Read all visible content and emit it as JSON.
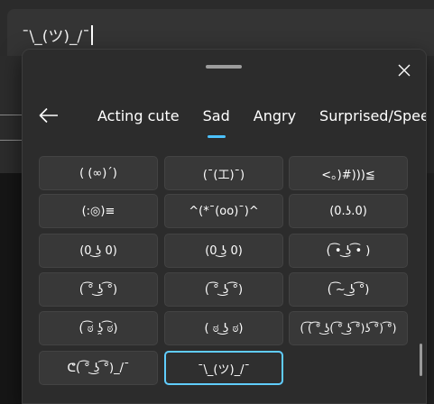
{
  "input": {
    "text": "¯\\_(ツ)_/¯"
  },
  "panel": {
    "close_icon": "close-icon",
    "back_icon": "back-arrow-icon",
    "tabs": [
      {
        "label": "Acting cute",
        "active": false
      },
      {
        "label": "Sad",
        "active": true
      },
      {
        "label": "Angry",
        "active": false
      },
      {
        "label": "Surprised/Speechless",
        "active": false
      }
    ],
    "accent_color": "#4cc2ff",
    "kaomoji_rows": [
      [
        "( (∞)´)",
        "(¯(工)¯)",
        "<。)#)))≦"
      ],
      [
        "(:◎)≡",
        "^(*¯(oo)¯)^",
        "(0.ʖ.0)"
      ],
      [
        "(0 ͜ʖ 0)",
        "(0 ͜ʖ 0)",
        "( ͡• ͜ʖ ͡• )"
      ],
      [
        "( ͡° ͜ʖ ͡°)",
        "( ͡° ͜ʖ ͡°)",
        "( ͡~ ͜ʖ ͡°)"
      ],
      [
        "( ͡ಠ ʖ̯ ͡ಠ)",
        "( ಠ ͜ʖ ಠ)",
        "( ͡( ͡° ͜ʖ( ͡° ͜ʖ ͡°)ʖ ͡°) ͡°)"
      ],
      [
        "ᕦ( ͡° ͜ʖ ͡°)_/¯",
        "¯\\_(ツ)_/¯"
      ]
    ],
    "selected": "¯\\_(ツ)_/¯"
  }
}
